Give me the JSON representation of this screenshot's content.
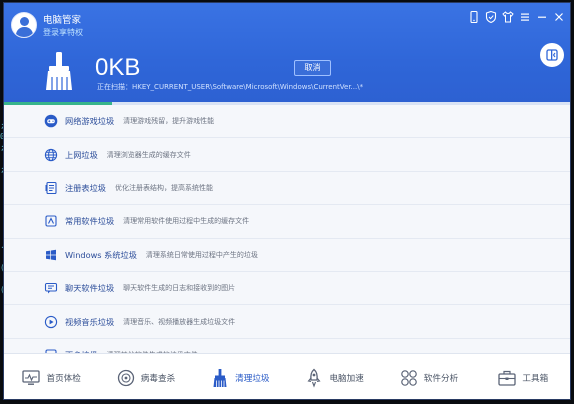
{
  "header": {
    "app_title": "电脑管家",
    "login_link": "登录享特权",
    "scan_size": "0KB",
    "scan_status": "正在扫描：HKEY_CURRENT_USER\\Software\\Microsoft\\Windows\\CurrentVer...\\*",
    "cancel_label": "取消",
    "progress_fraction": 0.19
  },
  "window_controls": [
    "phone-icon",
    "shield-icon",
    "shirt-icon",
    "menu-icon",
    "minimize-icon",
    "close-icon"
  ],
  "categories": [
    {
      "name": "网络游戏垃圾",
      "desc": "清理游戏残留，提升游戏性能",
      "icon": "gamepad-icon"
    },
    {
      "name": "上网垃圾",
      "desc": "清理浏览器生成的缓存文件",
      "icon": "globe-icon"
    },
    {
      "name": "注册表垃圾",
      "desc": "优化注册表结构，提高系统性能",
      "icon": "registry-icon"
    },
    {
      "name": "常用软件垃圾",
      "desc": "清理常用软件使用过程中生成的缓存文件",
      "icon": "software-icon"
    },
    {
      "name": "Windows 系统垃圾",
      "desc": "清理系统日常使用过程中产生的垃圾",
      "icon": "windows-icon"
    },
    {
      "name": "聊天软件垃圾",
      "desc": "聊天软件生成的日志和接收到的图片",
      "icon": "chat-icon"
    },
    {
      "name": "视频音乐垃圾",
      "desc": "清理音乐、视频播放器生成垃圾文件",
      "icon": "play-icon"
    },
    {
      "name": "更多垃圾",
      "desc": "清理其他软件生成的垃圾文件",
      "icon": "more-icon"
    }
  ],
  "nav": [
    {
      "label": "首页体检",
      "icon": "monitor-icon"
    },
    {
      "label": "病毒查杀",
      "icon": "shield-scan-icon"
    },
    {
      "label": "清理垃圾",
      "icon": "broom-icon",
      "active": true
    },
    {
      "label": "电脑加速",
      "icon": "rocket-icon"
    },
    {
      "label": "软件分析",
      "icon": "gear-grid-icon"
    },
    {
      "label": "工具箱",
      "icon": "toolbox-icon"
    }
  ],
  "colors": {
    "header_blue": "#2f66d8",
    "progress_green": "#37b48c",
    "accent_text": "#2a5bc7"
  }
}
